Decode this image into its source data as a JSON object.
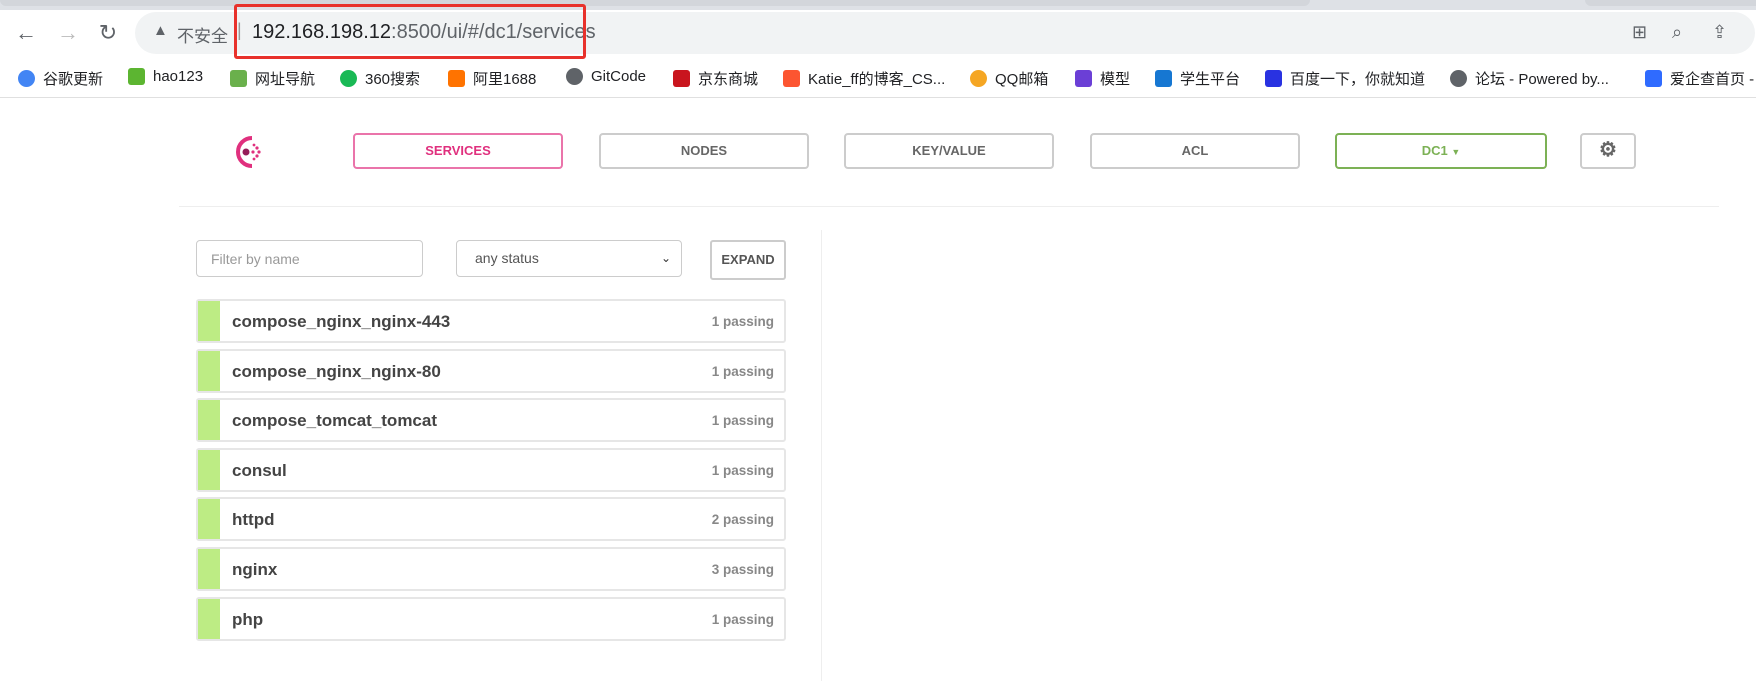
{
  "browser": {
    "insecure_label": "不安全",
    "url_host": "192.168.198.12",
    "url_rest": ":8500/ui/#/dc1/services",
    "bookmarks": [
      {
        "label": "谷歌更新",
        "icon": "chrome-icon",
        "color": "#4285f4"
      },
      {
        "label": "hao123",
        "icon": "hao123-icon",
        "color": "#5cb531"
      },
      {
        "label": "网址导航",
        "icon": "2345-icon",
        "color": "#6ab04c"
      },
      {
        "label": "360搜索",
        "icon": "360-icon",
        "color": "#19b955"
      },
      {
        "label": "阿里1688",
        "icon": "1688-icon",
        "color": "#ff7300"
      },
      {
        "label": "GitCode",
        "icon": "globe-icon",
        "color": "#5f6368"
      },
      {
        "label": "京东商城",
        "icon": "jd-icon",
        "color": "#c9151e"
      },
      {
        "label": "Katie_ff的博客_CS...",
        "icon": "csdn-icon",
        "color": "#fc5531"
      },
      {
        "label": "QQ邮箱",
        "icon": "qqmail-icon",
        "color": "#f5a623"
      },
      {
        "label": "模型",
        "icon": "zl-icon",
        "color": "#6b3fd6"
      },
      {
        "label": "学生平台",
        "icon": "student-icon",
        "color": "#1677d2"
      },
      {
        "label": "百度一下，你就知道",
        "icon": "baidu-icon",
        "color": "#2932e1"
      },
      {
        "label": "论坛 - Powered by...",
        "icon": "globe-icon",
        "color": "#5f6368"
      },
      {
        "label": "爱企查首页 -",
        "icon": "aiqicha-icon",
        "color": "#2f6bff"
      }
    ]
  },
  "nav": {
    "services": "SERVICES",
    "nodes": "NODES",
    "keyvalue": "KEY/VALUE",
    "acl": "ACL",
    "dc": "DC1",
    "active_color": "#e0307e",
    "dc_color": "#7cb155"
  },
  "filters": {
    "placeholder": "Filter by name",
    "status": "any status",
    "expand": "EXPAND"
  },
  "services": [
    {
      "name": "compose_nginx_nginx-443",
      "status": "1 passing"
    },
    {
      "name": "compose_nginx_nginx-80",
      "status": "1 passing"
    },
    {
      "name": "compose_tomcat_tomcat",
      "status": "1 passing"
    },
    {
      "name": "consul",
      "status": "1 passing"
    },
    {
      "name": "httpd",
      "status": "2 passing"
    },
    {
      "name": "nginx",
      "status": "3 passing"
    },
    {
      "name": "php",
      "status": "1 passing"
    }
  ]
}
